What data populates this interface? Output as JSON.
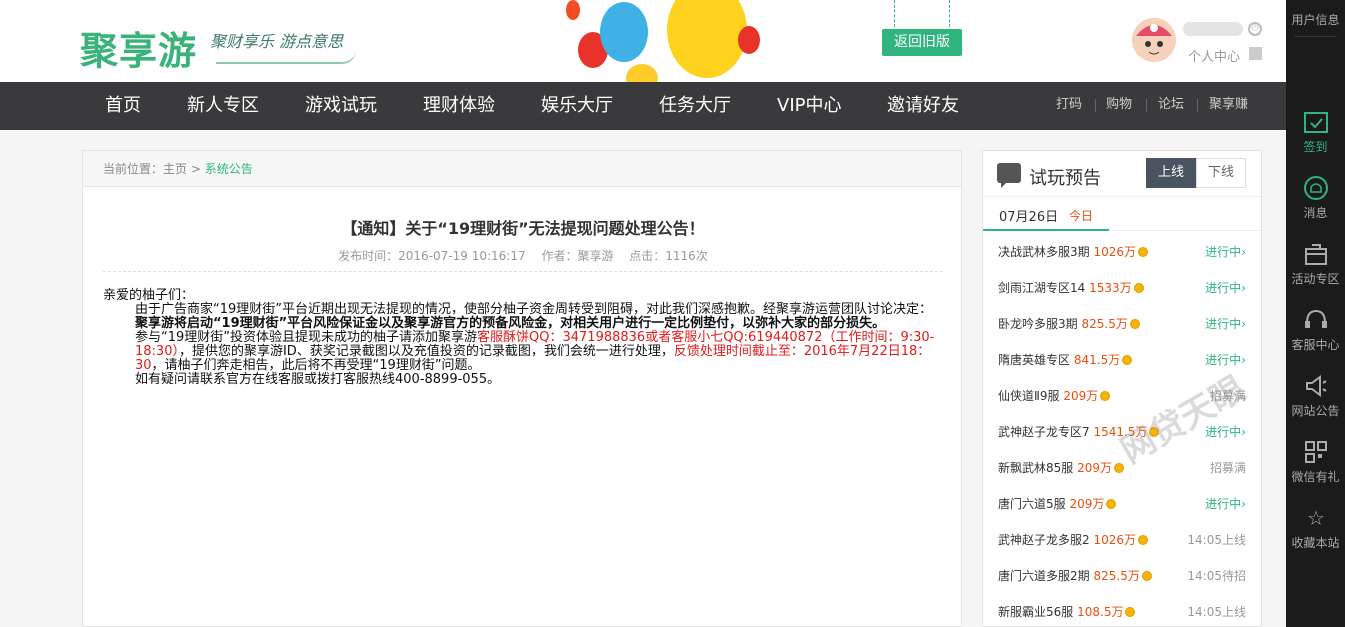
{
  "header": {
    "logo": "聚享游",
    "slogan": "聚财享乐 游点意思",
    "back_button": "返回旧版",
    "user_center": "个人中心"
  },
  "nav": {
    "items": [
      "首页",
      "新人专区",
      "游戏试玩",
      "理财体验",
      "娱乐大厅",
      "任务大厅",
      "VIP中心",
      "邀请好友"
    ],
    "right_links": [
      "打码",
      "购物",
      "论坛",
      "聚享赚"
    ]
  },
  "breadcrumb": {
    "prefix": "当前位置：",
    "home": "主页",
    "sep": ">",
    "current": "系统公告"
  },
  "article": {
    "title": "【通知】关于“19理财街”无法提现问题处理公告！",
    "publish_time": "发布时间：2016-07-19 10:16:17",
    "author": "作者：聚享游",
    "clicks": "点击：1116次",
    "greeting": "亲爱的柚子们：",
    "p1": "由于广告商家“19理财街”平台近期出现无法提现的情况，使部分柚子资金周转受到阻碍，对此我们深感抱歉。经聚享游运营团队讨论决定：",
    "p1_bold": "聚享游将启动“19理财街”平台风险保证金以及聚享游官方的预备风险金，对相关用户进行一定比例垫付，以弥补大家的部分损失。",
    "p2_a": "参与“19理财街”投资体验且提现未成功的柚子请添加聚享游",
    "p2_red1": "客服酥饼QQ：3471988836或者客服小七QQ:619440872（工作时间：9:30-18:30）",
    "p2_b": "，提供您的聚享游ID、获奖记录截图以及充值投资的记录截图，我们会统一进行处理，",
    "p2_red2": "反馈处理时间截止至：2016年7月22日18：30",
    "p2_c": "，请柚子们奔走相告，此后将不再受理“19理财街”问题。",
    "p3": "如有疑问请联系官方在线客服或拨打客服热线400-8899-055。"
  },
  "sidebar": {
    "title": "试玩预告",
    "tab_online": "上线",
    "tab_offline": "下线",
    "date": "07月26日",
    "today": "今日",
    "games": [
      {
        "name": "决战武林多服3期",
        "amount": "1026万",
        "status": "进行中",
        "status_type": "green"
      },
      {
        "name": "剑雨江湖专区14",
        "amount": "1533万",
        "status": "进行中",
        "status_type": "green"
      },
      {
        "name": "卧龙吟多服3期",
        "amount": "825.5万",
        "status": "进行中",
        "status_type": "green"
      },
      {
        "name": "隋唐英雄专区",
        "amount": "841.5万",
        "status": "进行中",
        "status_type": "green"
      },
      {
        "name": "仙侠道Ⅱ9服",
        "amount": "209万",
        "status": "招募满",
        "status_type": "gray"
      },
      {
        "name": "武神赵子龙专区7",
        "amount": "1541.5万",
        "status": "进行中",
        "status_type": "green"
      },
      {
        "name": "新飘武林85服",
        "amount": "209万",
        "status": "招募满",
        "status_type": "gray"
      },
      {
        "name": "唐门六道5服",
        "amount": "209万",
        "status": "进行中",
        "status_type": "green"
      },
      {
        "name": "武神赵子龙多服2",
        "amount": "1026万",
        "status": "14:05上线",
        "status_type": "gray"
      },
      {
        "name": "唐门六道多服2期",
        "amount": "825.5万",
        "status": "14:05待招",
        "status_type": "gray"
      },
      {
        "name": "新服霸业56服",
        "amount": "108.5万",
        "status": "14:05上线",
        "status_type": "gray"
      }
    ]
  },
  "toolbar": {
    "items": [
      "用户信息",
      "签到",
      "消息",
      "活动专区",
      "客服中心",
      "网站公告",
      "微信有礼",
      "收藏本站"
    ]
  },
  "watermark": "网贷天眼",
  "colors": {
    "brand_green": "#30b67d",
    "nav_bg": "#3a3a3c",
    "accent_orange": "#e8500d",
    "alert_red": "#e21b1b"
  }
}
